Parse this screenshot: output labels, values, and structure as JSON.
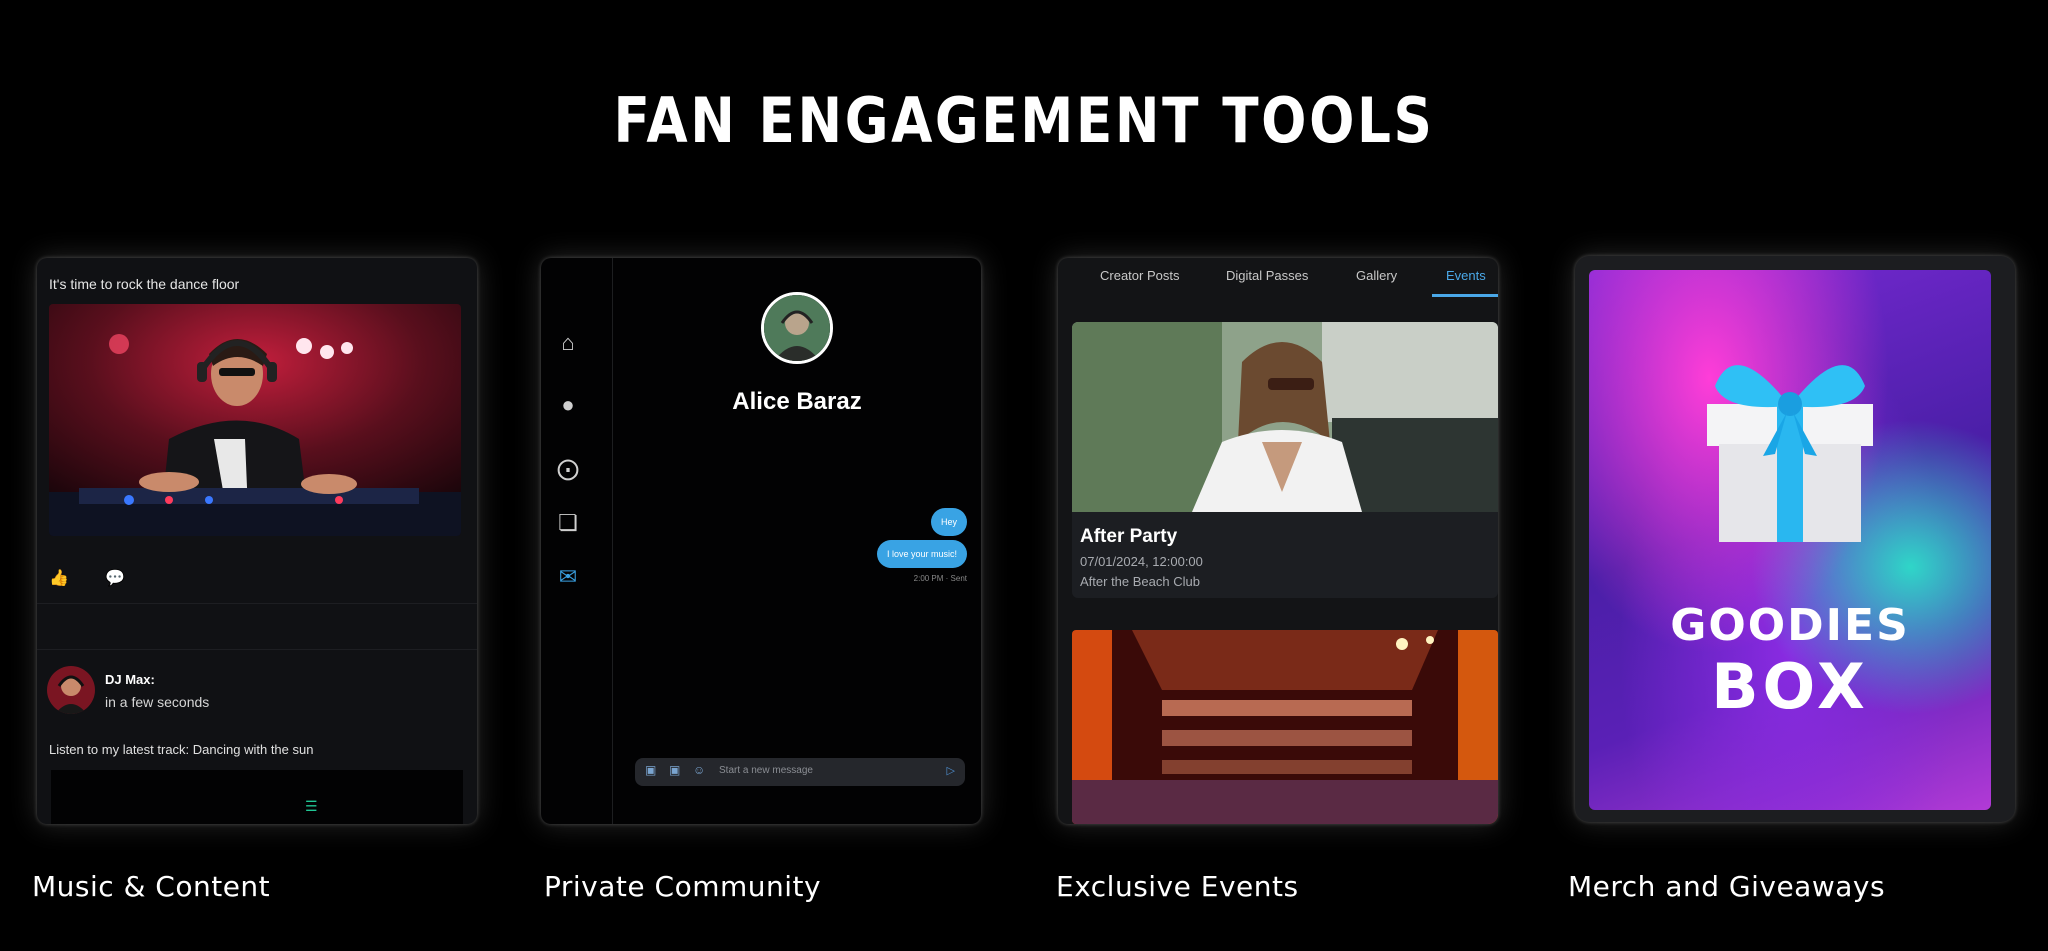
{
  "title": "FAN ENGAGEMENT TOOLS",
  "cards": [
    {
      "label": "Music & Content",
      "post_text": "It's time to rock the dance floor",
      "comment_name": "DJ Max:",
      "comment_text": "in a few seconds",
      "latest_text": "Listen to my latest track: Dancing with the sun"
    },
    {
      "label": "Private Community",
      "profile_name": "Alice Baraz",
      "bubble_1": "Hey",
      "bubble_2": "I love your music!",
      "msg_meta": "2:00 PM · Sent",
      "composer_placeholder": "Start a new message"
    },
    {
      "label": "Exclusive Events",
      "tabs": [
        "Creator Posts",
        "Digital Passes",
        "Gallery",
        "Events"
      ],
      "active_tab": "Events",
      "event_title": "After Party",
      "event_date": "07/01/2024, 12:00:00",
      "event_venue": "After the Beach Club"
    },
    {
      "label": "Merch and Giveaways",
      "goodies_line1": "GOODIES",
      "goodies_line2": "BOX"
    }
  ],
  "colors": {
    "accent": "#3aa0e0",
    "bubble": "#39a3e4",
    "player": "#21c795"
  }
}
